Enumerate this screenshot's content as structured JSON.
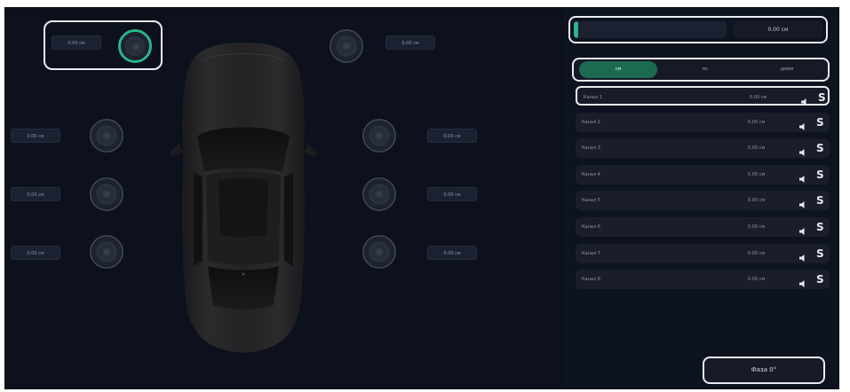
{
  "speakers": {
    "front_left": "0.00 см",
    "front_right": "0.00 см",
    "left": [
      "0.00 см",
      "0.00 см",
      "0.00 см"
    ],
    "right": [
      "0.00 см",
      "0.00 см",
      "0.00 см"
    ]
  },
  "slider": {
    "value_label": "0.00 см",
    "fraction": 0.03
  },
  "units": {
    "items": [
      "см",
      "мс",
      "дюйм"
    ],
    "selected": "см"
  },
  "channels": [
    {
      "name": "Канал 1",
      "value": "0.00 см",
      "solo": "S"
    },
    {
      "name": "Канал 2",
      "value": "0.00 см",
      "solo": "S"
    },
    {
      "name": "Канал 3",
      "value": "0.00 см",
      "solo": "S"
    },
    {
      "name": "Канал 4",
      "value": "0.00 см",
      "solo": "S"
    },
    {
      "name": "Канал 5",
      "value": "0.00 см",
      "solo": "S"
    },
    {
      "name": "Канал 6",
      "value": "0.00 см",
      "solo": "S"
    },
    {
      "name": "Канал 7",
      "value": "0.00 см",
      "solo": "S"
    },
    {
      "name": "Канал 8",
      "value": "0.00 см",
      "solo": "S"
    }
  ],
  "phase_button": "Фаза 0°",
  "colors": {
    "accent": "#2bb58c",
    "background": "#0c111d",
    "panel": "#0e1320"
  },
  "icons": {
    "mute": "speaker-icon",
    "solo": "solo-letter"
  }
}
